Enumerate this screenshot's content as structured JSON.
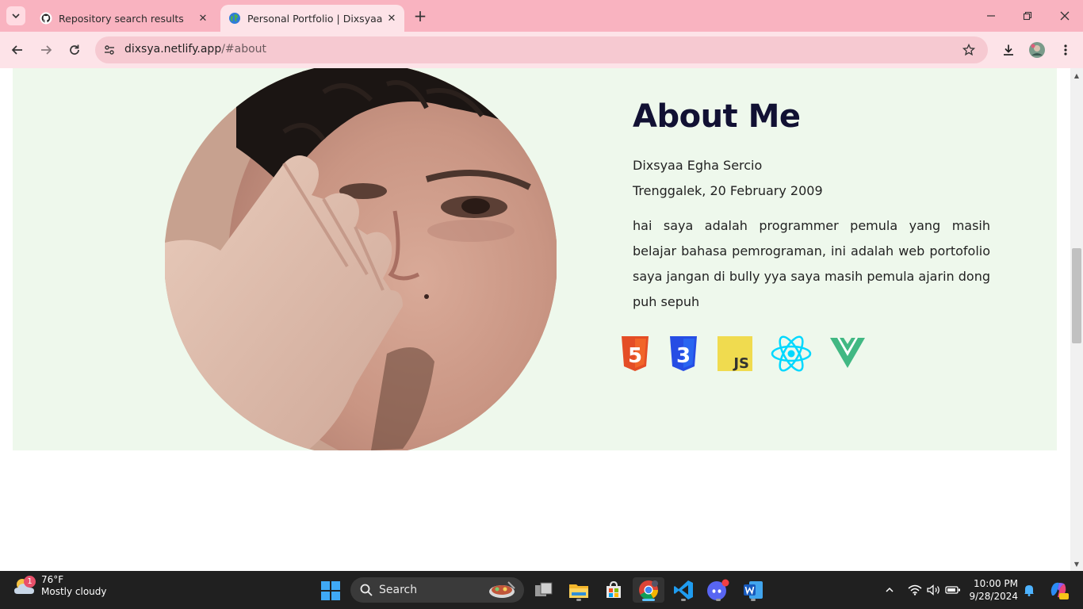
{
  "browser": {
    "tabs": [
      {
        "title": "Repository search results",
        "icon": "github-icon"
      },
      {
        "title": "Personal Portfolio | Dixsyaa",
        "icon": "globe-icon"
      }
    ],
    "url": {
      "host": "dixsya.netlify.app",
      "path": "/#about"
    }
  },
  "about": {
    "heading": "About Me",
    "name": "Dixsyaa Egha Sercio",
    "birth": "Trenggalek, 20 February 2009",
    "description": "hai saya adalah programmer pemula yang masih belajar bahasa pemrograman, ini adalah web portofolio saya jangan di bully yya saya masih pemula ajarin dong puh sepuh",
    "tech_icons": [
      {
        "name": "html5-icon",
        "text": "5",
        "color": "#e44d26"
      },
      {
        "name": "css3-icon",
        "text": "3",
        "color": "#264de4"
      },
      {
        "name": "javascript-icon",
        "text": "JS",
        "color": "#f0db4f"
      },
      {
        "name": "react-icon",
        "color": "#00d8ff"
      },
      {
        "name": "vue-icon",
        "color": "#41b883"
      }
    ],
    "background_color": "#eef8ec"
  },
  "taskbar": {
    "weather": {
      "temp": "76°F",
      "condition": "Mostly cloudy",
      "badge": "1"
    },
    "search_label": "Search",
    "clock": {
      "time": "10:00 PM",
      "date": "9/28/2024"
    }
  },
  "colors": {
    "tabbar": "#f9b3c0",
    "toolbar": "#fde3e8",
    "omnibox": "#f6c9d1",
    "taskbar": "#202020"
  }
}
